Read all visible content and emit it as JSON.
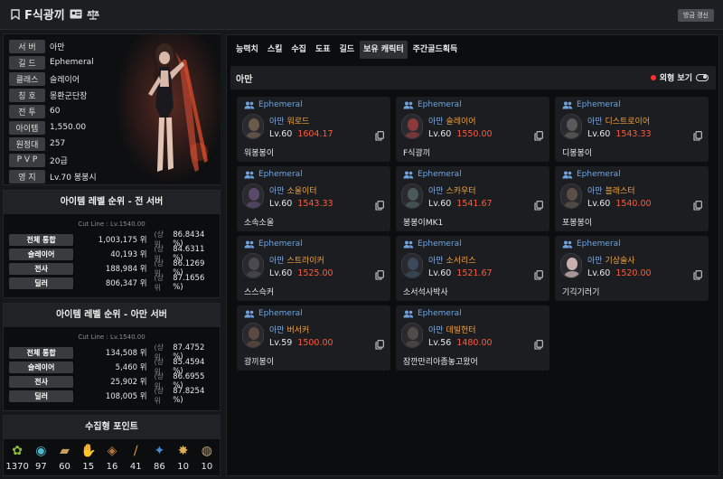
{
  "header": {
    "name": "F식광끼",
    "refresh_label": "방금 갱신"
  },
  "profile": {
    "rows": [
      {
        "label": "서 버",
        "value": "아만"
      },
      {
        "label": "길 드",
        "value": "Ephemeral"
      },
      {
        "label": "클래스",
        "value": "슬레이어"
      },
      {
        "label": "칭 호",
        "value": "몽환군단장"
      },
      {
        "label": "전 투",
        "value": "60"
      },
      {
        "label": "아이템",
        "value": "1,550.00"
      },
      {
        "label": "원정대",
        "value": "257"
      },
      {
        "label": "P V P",
        "value": "20급"
      },
      {
        "label": "영 지",
        "value": "Lv.70 봉봉시"
      }
    ]
  },
  "rank_all": {
    "title": "아이템 레벨 순위 - 전 서버",
    "cutline": "Cut Line : Lv.1540.00",
    "rows": [
      {
        "label": "전체 통합",
        "rank": "1,003,175 위",
        "sang": "(상위",
        "pct": "86.8434 %)"
      },
      {
        "label": "슬레이어",
        "rank": "40,193 위",
        "sang": "(상위",
        "pct": "84.6311 %)"
      },
      {
        "label": "전사",
        "rank": "188,984 위",
        "sang": "(상위",
        "pct": "86.1269 %)"
      },
      {
        "label": "딜러",
        "rank": "806,347 위",
        "sang": "(상위",
        "pct": "87.1656 %)"
      }
    ]
  },
  "rank_server": {
    "title": "아이템 레벨 순위 - 아만 서버",
    "cutline": "Cut Line : Lv.1540.00",
    "rows": [
      {
        "label": "전체 통합",
        "rank": "134,508 위",
        "sang": "(상위",
        "pct": "87.4752 %)"
      },
      {
        "label": "슬레이어",
        "rank": "5,460 위",
        "sang": "(상위",
        "pct": "85.4594 %)"
      },
      {
        "label": "전사",
        "rank": "25,902 위",
        "sang": "(상위",
        "pct": "86.6955 %)"
      },
      {
        "label": "딜러",
        "rank": "108,005 위",
        "sang": "(상위",
        "pct": "87.8254 %)"
      }
    ]
  },
  "collect": {
    "title": "수집형 포인트",
    "items": [
      {
        "icon": "mokoko-seed-icon",
        "value": "1370",
        "color": "#8fbf3a"
      },
      {
        "icon": "island-heart-icon",
        "value": "97",
        "color": "#4fb8c9"
      },
      {
        "icon": "great-painting-icon",
        "value": "60",
        "color": "#c9a05a"
      },
      {
        "icon": "giant-heart-icon",
        "value": "15",
        "color": "#d8d8d8"
      },
      {
        "icon": "ignea-token-icon",
        "value": "16",
        "color": "#b8793a"
      },
      {
        "icon": "adventure-tome-icon",
        "value": "41",
        "color": "#d59b3c"
      },
      {
        "icon": "world-tree-leaf-icon",
        "value": "86",
        "color": "#3f8fd8"
      },
      {
        "icon": "orpheus-star-icon",
        "value": "10",
        "color": "#e0b050"
      },
      {
        "icon": "sea-bounty-icon",
        "value": "10",
        "color": "#c8a070"
      }
    ]
  },
  "tabs": [
    {
      "label": "능력치",
      "active": false
    },
    {
      "label": "스킬",
      "active": false
    },
    {
      "label": "수집",
      "active": false
    },
    {
      "label": "도표",
      "active": false
    },
    {
      "label": "길드",
      "active": false
    },
    {
      "label": "보유 캐릭터",
      "active": true
    },
    {
      "label": "주간골드획득",
      "active": false
    }
  ],
  "section": {
    "title": "아만",
    "appearance_label": "외형 보기"
  },
  "characters": [
    {
      "guild": "Ephemeral",
      "server": "아만",
      "cls": "워로드",
      "lv": "Lv.60",
      "ilvl": "1604.17",
      "name": "워봉봉이",
      "tone": "#6a5a4a"
    },
    {
      "guild": "Ephemeral",
      "server": "아만",
      "cls": "슬레이어",
      "lv": "Lv.60",
      "ilvl": "1550.00",
      "name": "F식광끼",
      "tone": "#8a3a3a"
    },
    {
      "guild": "Ephemeral",
      "server": "아만",
      "cls": "디스트로이어",
      "lv": "Lv.60",
      "ilvl": "1543.33",
      "name": "디봉봉이",
      "tone": "#5a5a5a"
    },
    {
      "guild": "Ephemeral",
      "server": "아만",
      "cls": "소울이터",
      "lv": "Lv.60",
      "ilvl": "1543.33",
      "name": "소속소울",
      "tone": "#5a4a6a"
    },
    {
      "guild": "Ephemeral",
      "server": "아만",
      "cls": "스카우터",
      "lv": "Lv.60",
      "ilvl": "1541.67",
      "name": "봉봉이MK1",
      "tone": "#4a5a5a"
    },
    {
      "guild": "Ephemeral",
      "server": "아만",
      "cls": "블래스터",
      "lv": "Lv.60",
      "ilvl": "1540.00",
      "name": "포봉봉이",
      "tone": "#5a5048"
    },
    {
      "guild": "Ephemeral",
      "server": "아만",
      "cls": "스트라이커",
      "lv": "Lv.60",
      "ilvl": "1525.00",
      "name": "스스슥커",
      "tone": "#4a4a50"
    },
    {
      "guild": "Ephemeral",
      "server": "아만",
      "cls": "소서리스",
      "lv": "Lv.60",
      "ilvl": "1521.67",
      "name": "소서석사박사",
      "tone": "#3a4a5a"
    },
    {
      "guild": "Ephemeral",
      "server": "아만",
      "cls": "기상술사",
      "lv": "Lv.60",
      "ilvl": "1520.00",
      "name": "기긱기러기",
      "tone": "#c8b0b0"
    },
    {
      "guild": "Ephemeral",
      "server": "아만",
      "cls": "버서커",
      "lv": "Lv.59",
      "ilvl": "1500.00",
      "name": "광끼봉이",
      "tone": "#5a4a40"
    },
    {
      "guild": "Ephemeral",
      "server": "아만",
      "cls": "데빌헌터",
      "lv": "Lv.56",
      "ilvl": "1480.00",
      "name": "잠깐만리아좀놓고왔어",
      "tone": "#504a48"
    }
  ]
}
